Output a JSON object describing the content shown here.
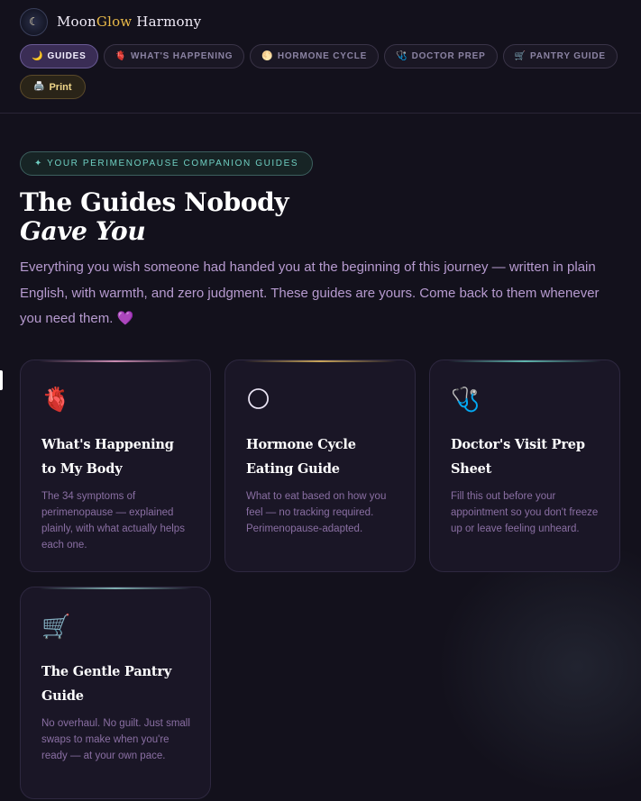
{
  "brand": {
    "name_part1": "Moon",
    "name_part2": "Glow",
    "name_part3": " Harmony",
    "logo_glyph": "☾"
  },
  "nav": [
    {
      "icon": "🌙",
      "label": "GUIDES",
      "active": true
    },
    {
      "icon": "🫀",
      "label": "WHAT'S HAPPENING"
    },
    {
      "icon": "🌕",
      "label": "HORMONE CYCLE"
    },
    {
      "icon": "🩺",
      "label": "DOCTOR PREP"
    },
    {
      "icon": "🛒",
      "label": "PANTRY GUIDE"
    },
    {
      "icon": "🖨️",
      "label": "Print"
    }
  ],
  "hero": {
    "pill": "✦ YOUR PERIMENOPAUSE COMPANION GUIDES",
    "title_line1": "The Guides Nobody",
    "title_line2": "Gave You",
    "lede": "Everything you wish someone had handed you at the beginning of this journey — written in plain English, with warmth, and zero judgment. These guides are yours. Come back to them whenever you need them. 💜"
  },
  "cards": [
    {
      "icon": "🫀",
      "title": "What's Happening to My Body",
      "desc": "The 34 symptoms of perimenopause — explained plainly, with what actually helps each one.",
      "accent": "#c98bb0"
    },
    {
      "icon": "🌕",
      "title": "Hormone Cycle Eating Guide",
      "desc": "What to eat based on how you feel — no tracking required. Perimenopause-adapted.",
      "accent": "#c9a55a"
    },
    {
      "icon": "🩺",
      "title": "Doctor's Visit Prep Sheet",
      "desc": "Fill this out before your appointment so you don't freeze up or leave feeling unheard.",
      "accent": "#5fb5ad"
    },
    {
      "icon": "🛒",
      "title": "The Gentle Pantry Guide",
      "desc": "No overhaul. No guilt. Just small swaps to make when you're ready — at your own pace.",
      "accent": "#7fb0b0"
    }
  ],
  "colors": {
    "background": "#13111c",
    "accent_purple": "#3a2d55",
    "accent_gold": "#e9b949",
    "accent_teal": "#6fcfc2"
  }
}
